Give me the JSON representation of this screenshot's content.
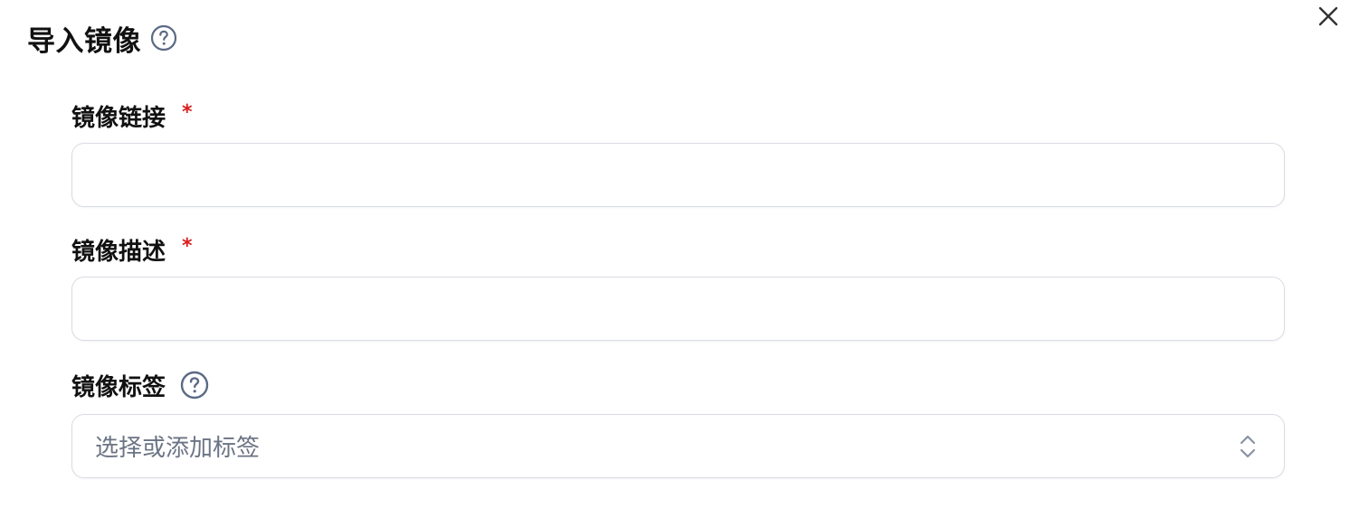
{
  "dialog": {
    "title": "导入镜像",
    "help_icon": "question-circle-icon",
    "close_icon": "close-icon"
  },
  "fields": {
    "image_link": {
      "label": "镜像链接",
      "required_mark": "*",
      "value": "",
      "placeholder": ""
    },
    "image_description": {
      "label": "镜像描述",
      "required_mark": "*",
      "value": "",
      "placeholder": ""
    },
    "image_tags": {
      "label": "镜像标签",
      "help_icon": "question-circle-icon",
      "placeholder": "选择或添加标签",
      "indicator_icon": "chevron-up-down-icon"
    }
  },
  "colors": {
    "text": "#111111",
    "required": "#d81e1e",
    "icon": "#5b6a85",
    "border": "#d9dce3",
    "placeholder": "#6b7484"
  }
}
